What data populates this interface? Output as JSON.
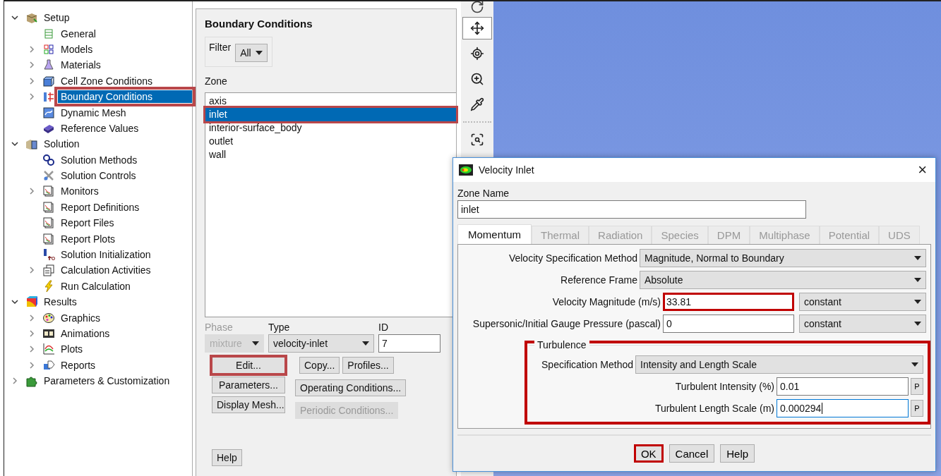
{
  "tree": [
    {
      "label": "Setup",
      "kind": "setup",
      "expandable": true,
      "expanded": true,
      "highlighted": false,
      "selected": false,
      "children": [
        {
          "label": "General",
          "kind": "general",
          "highlighted": false,
          "selected": false
        },
        {
          "label": "Models",
          "kind": "models",
          "expandable": true,
          "expanded": false,
          "highlighted": false,
          "selected": false
        },
        {
          "label": "Materials",
          "kind": "materials",
          "expandable": true,
          "expanded": false,
          "highlighted": false,
          "selected": false
        },
        {
          "label": "Cell Zone Conditions",
          "kind": "cellzone",
          "expandable": true,
          "expanded": false,
          "highlighted": false,
          "selected": false
        },
        {
          "label": "Boundary Conditions",
          "kind": "boundary",
          "expandable": true,
          "expanded": false,
          "highlighted": true,
          "selected": true
        },
        {
          "label": "Dynamic Mesh",
          "kind": "mesh",
          "highlighted": false,
          "selected": false
        },
        {
          "label": "Reference Values",
          "kind": "book",
          "highlighted": false,
          "selected": false
        }
      ]
    },
    {
      "label": "Solution",
      "kind": "solution",
      "expandable": true,
      "expanded": true,
      "highlighted": false,
      "selected": false,
      "children": [
        {
          "label": "Solution Methods",
          "kind": "methods",
          "highlighted": false,
          "selected": false
        },
        {
          "label": "Solution Controls",
          "kind": "controls",
          "highlighted": false,
          "selected": false
        },
        {
          "label": "Monitors",
          "kind": "monitor",
          "expandable": true,
          "expanded": false,
          "highlighted": false,
          "selected": false
        },
        {
          "label": "Report Definitions",
          "kind": "monitor",
          "highlighted": false,
          "selected": false
        },
        {
          "label": "Report Files",
          "kind": "monitor",
          "highlighted": false,
          "selected": false
        },
        {
          "label": "Report Plots",
          "kind": "monitor",
          "highlighted": false,
          "selected": false
        },
        {
          "label": "Solution Initialization",
          "kind": "init",
          "highlighted": false,
          "selected": false
        },
        {
          "label": "Calculation Activities",
          "kind": "activities",
          "expandable": true,
          "expanded": false,
          "highlighted": false,
          "selected": false
        },
        {
          "label": "Run Calculation",
          "kind": "run",
          "highlighted": false,
          "selected": false
        }
      ]
    },
    {
      "label": "Results",
      "kind": "results",
      "expandable": true,
      "expanded": true,
      "highlighted": false,
      "selected": false,
      "children": [
        {
          "label": "Graphics",
          "kind": "graphics",
          "expandable": true,
          "expanded": false,
          "highlighted": false,
          "selected": false
        },
        {
          "label": "Animations",
          "kind": "animations",
          "expandable": true,
          "expanded": false,
          "highlighted": false,
          "selected": false
        },
        {
          "label": "Plots",
          "kind": "plots",
          "expandable": true,
          "expanded": false,
          "highlighted": false,
          "selected": false
        },
        {
          "label": "Reports",
          "kind": "reports",
          "expandable": true,
          "expanded": false,
          "highlighted": false,
          "selected": false
        }
      ]
    },
    {
      "label": "Parameters & Customization",
      "kind": "parameters",
      "expandable": true,
      "expanded": false,
      "highlighted": false,
      "selected": false
    }
  ],
  "panel": {
    "title": "Boundary Conditions",
    "filter": {
      "label": "Filter",
      "value": "All"
    },
    "zone_label": "Zone",
    "zones": [
      {
        "label": "axis",
        "selected": false,
        "highlighted": false
      },
      {
        "label": "inlet",
        "selected": true,
        "highlighted": true
      },
      {
        "label": "interior-surface_body",
        "selected": false,
        "highlighted": false
      },
      {
        "label": "outlet",
        "selected": false,
        "highlighted": false
      },
      {
        "label": "wall",
        "selected": false,
        "highlighted": false
      }
    ],
    "phase": {
      "label": "Phase",
      "value": "mixture",
      "disabled": true
    },
    "type": {
      "label": "Type",
      "value": "velocity-inlet"
    },
    "id": {
      "label": "ID",
      "value": "7"
    },
    "buttons_left": [
      {
        "label": "Edit...",
        "highlighted": true,
        "disabled": false
      },
      {
        "label": "Parameters...",
        "highlighted": false,
        "disabled": false
      },
      {
        "label": "Display Mesh...",
        "highlighted": false,
        "disabled": false
      }
    ],
    "buttons_right": [
      {
        "label": "Copy...",
        "disabled": false
      },
      {
        "label": "Profiles...",
        "disabled": false
      },
      {
        "label": "Operating Conditions...",
        "disabled": false
      },
      {
        "label": "Periodic Conditions...",
        "disabled": true
      }
    ],
    "help": "Help"
  },
  "tools": [
    {
      "kind": "rotate",
      "selected": false
    },
    {
      "kind": "move",
      "selected": true
    },
    {
      "kind": "zoomfit",
      "selected": false
    },
    {
      "kind": "zoomin",
      "selected": false
    },
    {
      "kind": "probe",
      "selected": false
    },
    {
      "kind": "separator"
    },
    {
      "kind": "zoombox",
      "selected": false
    }
  ],
  "dialog": {
    "title": "Velocity Inlet",
    "close": "×",
    "zone_name_label": "Zone Name",
    "zone_name": "inlet",
    "tabs": [
      {
        "label": "Momentum",
        "selected": true
      },
      {
        "label": "Thermal",
        "selected": false
      },
      {
        "label": "Radiation",
        "selected": false
      },
      {
        "label": "Species",
        "selected": false
      },
      {
        "label": "DPM",
        "selected": false
      },
      {
        "label": "Multiphase",
        "selected": false
      },
      {
        "label": "Potential",
        "selected": false
      },
      {
        "label": "UDS",
        "selected": false
      }
    ],
    "rows": [
      {
        "label": "Velocity Specification Method",
        "kind": "select",
        "value": "Magnitude, Normal to Boundary"
      },
      {
        "label": "Reference Frame",
        "kind": "select",
        "value": "Absolute"
      },
      {
        "label": "Velocity Magnitude (m/s)",
        "kind": "field-select",
        "value": "33.81",
        "option": "constant",
        "highlighted": true
      },
      {
        "label": "Supersonic/Initial Gauge Pressure (pascal)",
        "kind": "field-select",
        "value": "0",
        "option": "constant",
        "highlighted": false
      }
    ],
    "turbulence": {
      "title": "Turbulence",
      "highlighted": true,
      "rows": [
        {
          "label": "Specification Method",
          "kind": "select",
          "value": "Intensity and Length Scale",
          "focused": false
        },
        {
          "label": "Turbulent Intensity (%)",
          "kind": "field-param",
          "value": "0.01",
          "button": "P",
          "focused": false
        },
        {
          "label": "Turbulent Length Scale (m)",
          "kind": "field-param",
          "value": "0.000294",
          "button": "P",
          "focused": true
        }
      ]
    },
    "buttons": [
      {
        "label": "OK",
        "highlighted": true
      },
      {
        "label": "Cancel",
        "highlighted": false
      },
      {
        "label": "Help",
        "highlighted": false
      }
    ]
  }
}
